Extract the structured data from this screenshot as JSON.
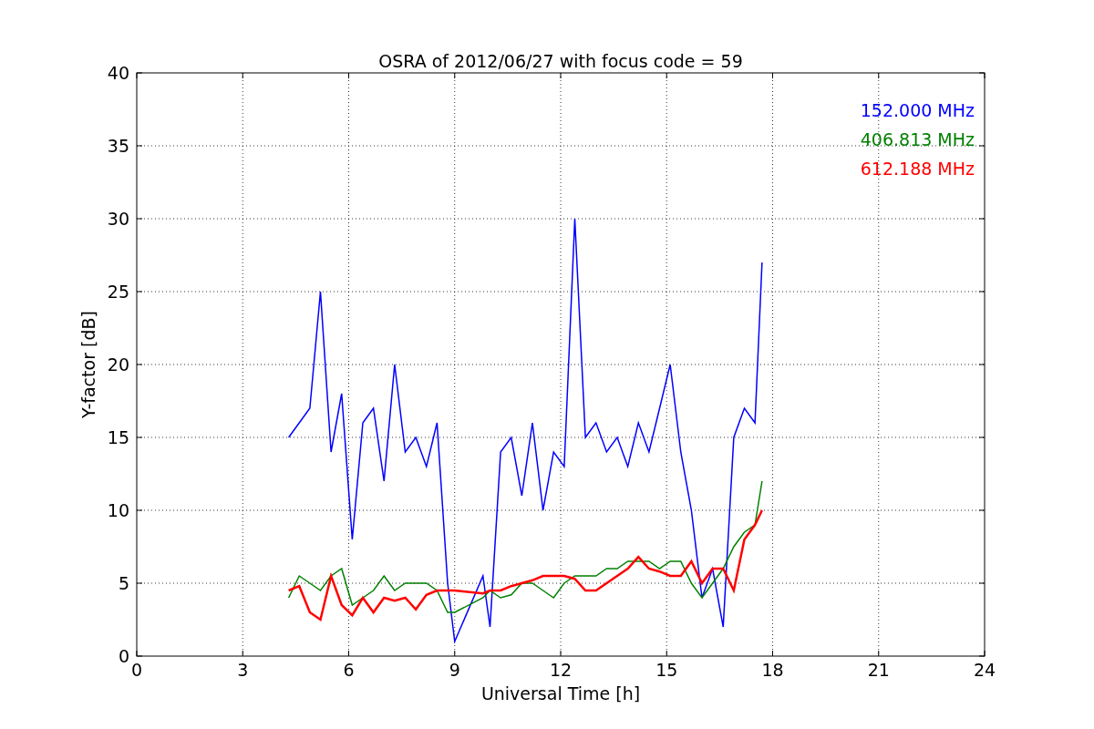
{
  "chart_data": {
    "type": "line",
    "title": "OSRA of 2012/06/27 with focus code = 59",
    "xlabel": "Universal Time [h]",
    "ylabel": "Y-factor [dB]",
    "x": [
      4.3,
      4.6,
      4.9,
      5.2,
      5.5,
      5.8,
      6.1,
      6.4,
      6.7,
      7.0,
      7.3,
      7.6,
      7.9,
      8.2,
      8.5,
      8.8,
      9.0,
      9.8,
      10.0,
      10.3,
      10.6,
      10.9,
      11.2,
      11.5,
      11.8,
      12.1,
      12.4,
      12.7,
      13.0,
      13.3,
      13.6,
      13.9,
      14.2,
      14.5,
      14.8,
      15.1,
      15.4,
      15.7,
      16.0,
      16.3,
      16.6,
      16.9,
      17.2,
      17.5,
      17.7
    ],
    "series": [
      {
        "name": "152.000 MHz",
        "color": "#0000ff",
        "values": [
          15,
          16,
          17,
          25,
          14,
          18,
          8,
          16,
          17,
          12,
          20,
          14,
          15,
          13,
          16,
          5,
          1,
          5.5,
          2,
          14,
          15,
          11,
          16,
          10,
          14,
          13,
          30,
          15,
          16,
          14,
          15,
          13,
          16,
          14,
          17,
          20,
          14,
          10,
          4,
          6,
          2,
          15,
          17,
          16,
          27
        ]
      },
      {
        "name": "406.813 MHz",
        "color": "#008000",
        "values": [
          4,
          5.5,
          5,
          4.5,
          5.5,
          6,
          3.5,
          4,
          4.5,
          5.5,
          4.5,
          5,
          5,
          5,
          4.5,
          3,
          3,
          4,
          4.5,
          4,
          4.2,
          5,
          5,
          4.5,
          4,
          5,
          5.5,
          5.5,
          5.5,
          6,
          6,
          6.5,
          6.5,
          6.5,
          6,
          6.5,
          6.5,
          5,
          4,
          5,
          6,
          7.5,
          8.5,
          9,
          12
        ]
      },
      {
        "name": "612.188 MHz",
        "color": "#ff0000",
        "values": [
          4.5,
          4.8,
          3,
          2.5,
          5.5,
          3.5,
          2.8,
          4,
          3,
          4,
          3.8,
          4,
          3.2,
          4.2,
          4.5,
          4.5,
          4.5,
          4.3,
          4.5,
          4.5,
          4.8,
          5,
          5.2,
          5.5,
          5.5,
          5.5,
          5.3,
          4.5,
          4.5,
          5,
          5.5,
          6,
          6.8,
          6,
          5.8,
          5.5,
          5.5,
          6.5,
          5,
          6,
          6,
          4.5,
          8,
          9,
          10
        ]
      }
    ],
    "grid": true,
    "xlim": [
      0,
      24
    ],
    "ylim": [
      0,
      40
    ],
    "xticks": [
      0,
      3,
      6,
      9,
      12,
      15,
      18,
      21,
      24
    ],
    "yticks": [
      0,
      5,
      10,
      15,
      20,
      25,
      30,
      35,
      40
    ]
  }
}
